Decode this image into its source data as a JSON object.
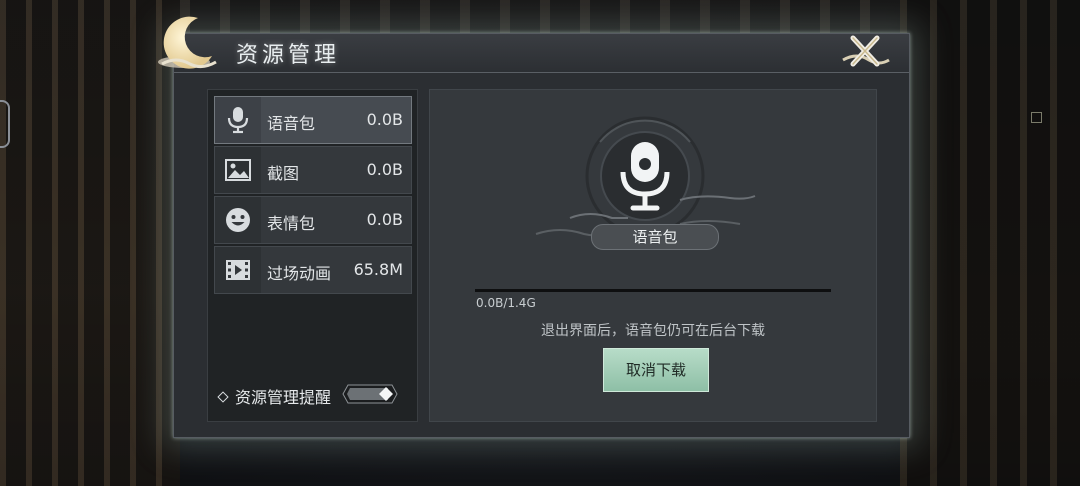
{
  "panel": {
    "title": "资源管理",
    "close_icon": "close-x-icon"
  },
  "resources": [
    {
      "label": "语音包",
      "size": "0.0B",
      "icon": "microphone-icon",
      "active": true
    },
    {
      "label": "截图",
      "size": "0.0B",
      "icon": "image-icon",
      "active": false
    },
    {
      "label": "表情包",
      "size": "0.0B",
      "icon": "smiley-icon",
      "active": false
    },
    {
      "label": "过场动画",
      "size": "65.8M",
      "icon": "film-icon",
      "active": false
    }
  ],
  "reminder": {
    "label": "资源管理提醒",
    "toggle_on": true
  },
  "detail": {
    "name": "语音包",
    "progress_text": "0.0B/1.4G",
    "progress_fraction": 0.0,
    "note": "退出界面后，语音包仍可在后台下载",
    "cancel_label": "取消下载"
  },
  "colors": {
    "accent": "#9fe0c8",
    "button": "#a6d2bb",
    "panel": "#2b2e32"
  }
}
